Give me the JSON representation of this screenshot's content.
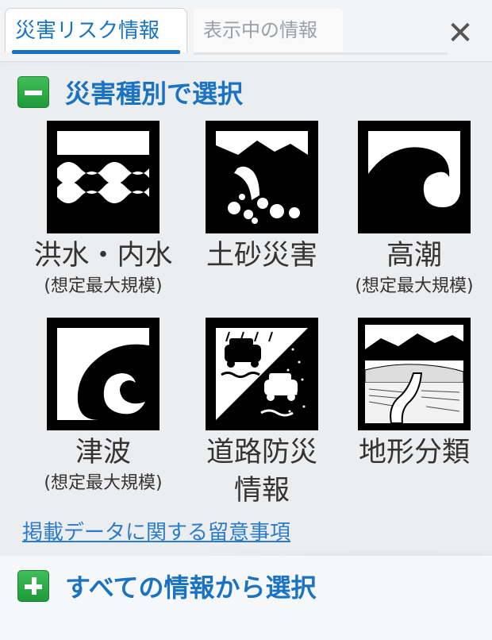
{
  "tabs": [
    {
      "label": "災害リスク情報",
      "active": true
    },
    {
      "label": "表示中の情報",
      "active": false
    }
  ],
  "close_icon": "✕",
  "section_hazard": {
    "title": "災害種別で選択",
    "expanded": true
  },
  "hazards": [
    {
      "label": "洪水・内水",
      "label2": "",
      "sub": "(想定最大規模)",
      "icon": "flood-icon"
    },
    {
      "label": "土砂災害",
      "label2": "",
      "sub": "",
      "icon": "landslide-icon"
    },
    {
      "label": "高潮",
      "label2": "",
      "sub": "(想定最大規模)",
      "icon": "storm-surge-icon"
    },
    {
      "label": "津波",
      "label2": "",
      "sub": "(想定最大規模)",
      "icon": "tsunami-icon"
    },
    {
      "label": "道路防災",
      "label2": "情報",
      "sub": "",
      "icon": "road-disaster-icon"
    },
    {
      "label": "地形分類",
      "label2": "",
      "sub": "",
      "icon": "terrain-classification-icon"
    }
  ],
  "notes_link": "掲載データに関する留意事項",
  "section_all": {
    "title": "すべての情報から選択",
    "expanded": false
  },
  "colors": {
    "accent": "#1a73c0",
    "toggle_green": "#2aa84a",
    "link": "#2a7ccc"
  }
}
